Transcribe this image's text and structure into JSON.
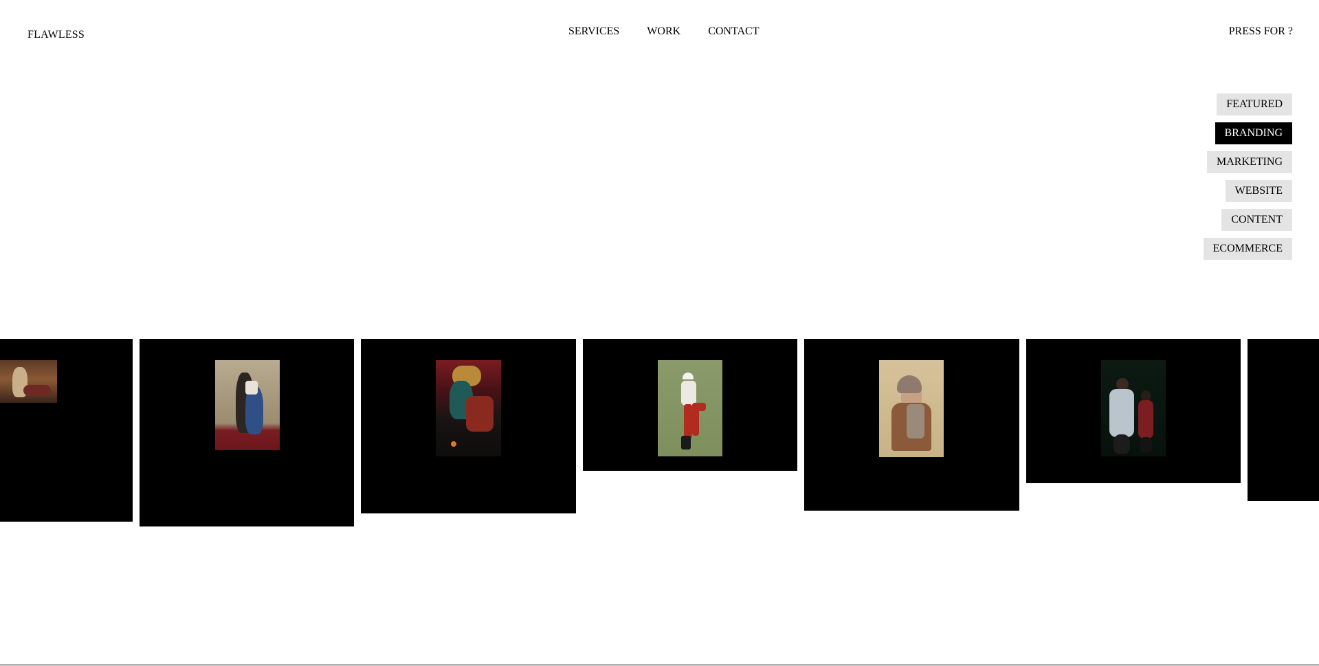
{
  "header": {
    "brand": "FLAWLESS",
    "nav": [
      {
        "label": "SERVICES"
      },
      {
        "label": "WORK"
      },
      {
        "label": "CONTACT"
      }
    ],
    "press_label": "PRESS FOR ?"
  },
  "filters": [
    {
      "label": "FEATURED",
      "active": false
    },
    {
      "label": "BRANDING",
      "active": true
    },
    {
      "label": "MARKETING",
      "active": false
    },
    {
      "label": "WEBSITE",
      "active": false
    },
    {
      "label": "CONTENT",
      "active": false
    },
    {
      "label": "ECOMMERCE",
      "active": false
    }
  ],
  "colors": {
    "filter_bg": "#e4e4e4",
    "filter_active_bg": "#000000",
    "card_bg": "#000000"
  }
}
